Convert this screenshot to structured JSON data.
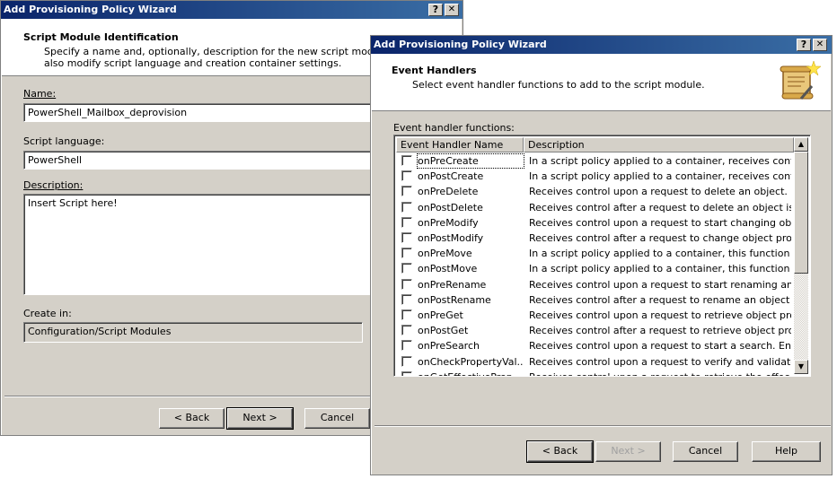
{
  "back_dialog": {
    "title": "Add Provisioning Policy Wizard",
    "help_glyph": "?",
    "close_glyph": "✕",
    "header_title": "Script Module Identification",
    "header_desc_1": "Specify a name and, optionally, description for the new script module. You",
    "header_desc_2": "also modify script language and creation container settings.",
    "name_label": "Name:",
    "name_value": "PowerShell_Mailbox_deprovision",
    "language_label": "Script language:",
    "language_value": "PowerShell",
    "description_label": "Description:",
    "description_value": "Insert Script here!",
    "create_in_label": "Create in:",
    "create_in_value": "Configuration/Script Modules",
    "back_label": "< Back",
    "next_label": "Next >",
    "cancel_label": "Cancel"
  },
  "front_dialog": {
    "title": "Add Provisioning Policy Wizard",
    "help_glyph": "?",
    "close_glyph": "✕",
    "header_title": "Event Handlers",
    "header_desc": "Select event handler functions to add to the script module.",
    "list_label": "Event handler functions:",
    "columns": [
      "Event Handler Name",
      "Description"
    ],
    "rows": [
      {
        "name": "onPreCreate",
        "desc": "In a script policy applied to a container, receives control ..."
      },
      {
        "name": "onPostCreate",
        "desc": "In a script policy applied to a container, receives control ..."
      },
      {
        "name": "onPreDelete",
        "desc": "Receives control upon a request to delete an object. En..."
      },
      {
        "name": "onPostDelete",
        "desc": "Receives control after a request to delete an object is c..."
      },
      {
        "name": "onPreModify",
        "desc": "Receives control upon a request to start changing objec..."
      },
      {
        "name": "onPostModify",
        "desc": "Receives control after a request to change object prope..."
      },
      {
        "name": "onPreMove",
        "desc": "In a script policy applied to a container, this function rec..."
      },
      {
        "name": "onPostMove",
        "desc": "In a script policy applied to a container, this function rec..."
      },
      {
        "name": "onPreRename",
        "desc": "Receives control upon a request to start renaming an ob..."
      },
      {
        "name": "onPostRename",
        "desc": "Receives control after a request to rename an object is ..."
      },
      {
        "name": "onPreGet",
        "desc": "Receives control upon a request to retrieve object prop..."
      },
      {
        "name": "onPostGet",
        "desc": "Receives control after a request to retrieve object prop..."
      },
      {
        "name": "onPreSearch",
        "desc": "Receives control upon a request to start a search. Enabl..."
      },
      {
        "name": "onCheckPropertyVal...",
        "desc": "Receives control upon a request to verify and validate t..."
      },
      {
        "name": "onGetEffectiveProp...",
        "desc": "Receives control upon a request to retrieve the effec..."
      }
    ],
    "back_label": "< Back",
    "next_label": "Next >",
    "cancel_label": "Cancel",
    "help_label": "Help"
  }
}
